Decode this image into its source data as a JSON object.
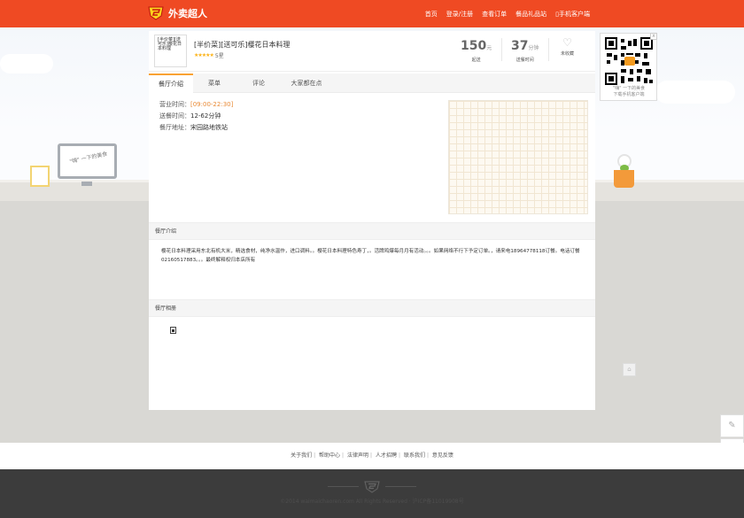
{
  "header": {
    "brand": "外卖超人",
    "nav": [
      "首页",
      "登录/注册",
      "查看订单",
      "餐品礼品站",
      "手机客户端"
    ]
  },
  "scene": {
    "monitor_text": "\"嗨\" 一下的美食"
  },
  "qr": {
    "close": "x",
    "caption_line1": "\"嗨\" 一下的美食",
    "caption_line2": "下载手机客户端"
  },
  "shop": {
    "logo_text": "[半价菜][送可乐]樱花日本料理",
    "name": "[半价菜][送可乐]樱花日本料理",
    "stars": "★★★★★",
    "rating": "5星",
    "min_order": {
      "value": "150",
      "unit": "元",
      "label": "起送"
    },
    "delivery_time": {
      "value": "37",
      "unit": "分钟",
      "label": "送餐时间"
    },
    "favorite_label": "未收藏"
  },
  "tabs": [
    "餐厅介绍",
    "菜单",
    "评论",
    "大家都在点"
  ],
  "info": {
    "hours_label": "营业时间：",
    "hours": "[09:00-22:30]",
    "delivery_label": "送餐时间：",
    "delivery": "12-62分钟",
    "address_label": "餐厅地址：",
    "address": "宋园路地铁站"
  },
  "intro": {
    "title": "餐厅介绍",
    "text": "樱花日本料理采用东北有机大米，精选食材，纯净水温作，进口调料。。樱花日本料理特色寿丁，。活牌鸡爆每月月有活动。。。如果网络不行下予定订单。，请来电18964778118订餐。电话订餐02160517883。。。最终解释权归本店所有"
  },
  "album": {
    "title": "餐厅相册"
  },
  "footer": {
    "links": [
      "关于我们",
      "帮助中心",
      "法律声明",
      "人才招聘",
      "联系我们",
      "意见反馈"
    ],
    "copyright": "©2014 waimaichaoren.com All Rights Reserved · 沪ICP备11019908号"
  },
  "colors": {
    "brand": "#ef4a23",
    "accent_tab": "#f9a233",
    "stars": "#fcb31a"
  },
  "icons": [
    "logo-badge-icon",
    "heart-icon",
    "edit-icon",
    "qr-icon",
    "phone-icon",
    "photo-icon"
  ]
}
